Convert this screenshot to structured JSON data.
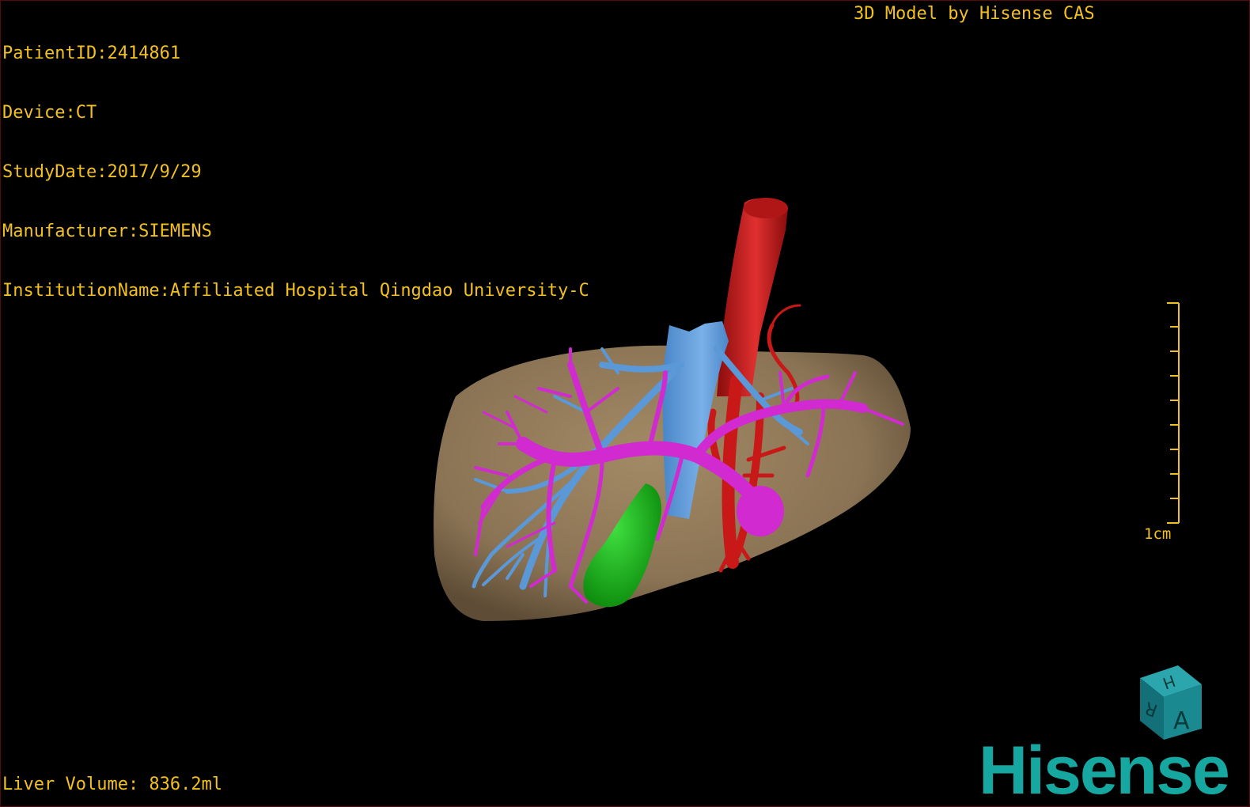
{
  "header": {
    "patient_id": "PatientID:2414861",
    "device": "Device:CT",
    "study_date": "StudyDate:2017/9/29",
    "manufacturer": "Manufacturer:SIEMENS",
    "institution": "InstitutionName:Affiliated Hospital Qingdao University-C"
  },
  "brand_text": "3D Model by Hisense CAS",
  "footer": {
    "liver_volume": "Liver Volume: 836.2ml"
  },
  "scale": {
    "label": "1cm"
  },
  "orientation_cube": {
    "faces": [
      "H",
      "R",
      "A"
    ],
    "color": "#1a8a90"
  },
  "logo": {
    "text": "Hisense",
    "color": "#16a8a0"
  },
  "colors": {
    "overlay_text": "#f2c020",
    "liver": "#8a7354",
    "hepatic_artery_aorta": "#c81818",
    "portal_vein": "#d02ad0",
    "hepatic_vein_ivc": "#5a98d8",
    "gallbladder": "#18b818"
  }
}
